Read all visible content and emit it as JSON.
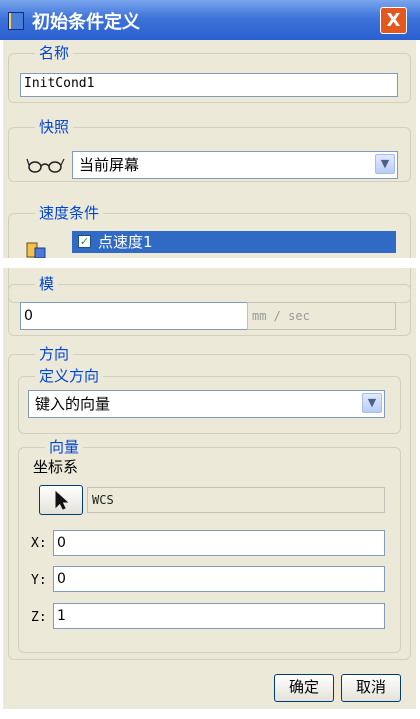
{
  "window": {
    "title": "初始条件定义",
    "close_glyph": "X"
  },
  "name_group": {
    "legend": "名称",
    "value": "InitCond1"
  },
  "snapshot_group": {
    "legend": "快照",
    "icon": "glasses-icon",
    "selected": "当前屏幕"
  },
  "velocity_group": {
    "legend": "速度条件",
    "icon": "velocity-condition-icon",
    "item_label": "点速度1",
    "item_checked": true
  },
  "magnitude_group": {
    "legend": "模",
    "value": "0",
    "unit": "mm / sec"
  },
  "direction_group": {
    "legend": "方向",
    "define_legend": "定义方向",
    "define_selected": "键入的向量",
    "vector_legend": "向量",
    "csys_label": "坐标系",
    "csys_value": "WCS",
    "x_label": "X:",
    "x_value": "0",
    "y_label": "Y:",
    "y_value": "0",
    "z_label": "Z:",
    "z_value": "1"
  },
  "buttons": {
    "ok": "确定",
    "cancel": "取消"
  },
  "colors": {
    "titlebar": "#2a5fd0",
    "dialog_bg": "#ece9d8",
    "legend_text": "#0046d5",
    "selection": "#316ac5"
  }
}
